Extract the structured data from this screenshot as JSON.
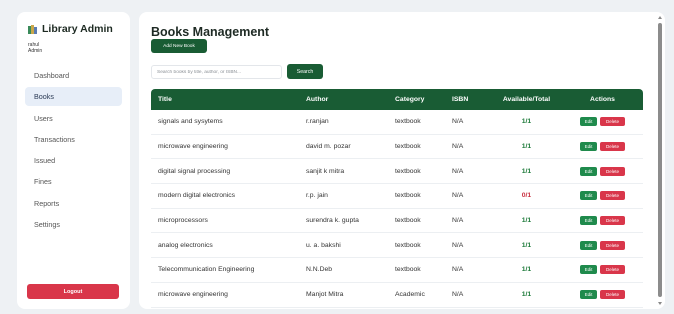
{
  "sidebar": {
    "brand": "Library Admin",
    "user_name": "rahul",
    "user_role": "Admin",
    "items": [
      {
        "label": "Dashboard"
      },
      {
        "label": "Books"
      },
      {
        "label": "Users"
      },
      {
        "label": "Transactions"
      },
      {
        "label": "Issued"
      },
      {
        "label": "Fines"
      },
      {
        "label": "Reports"
      },
      {
        "label": "Settings"
      }
    ],
    "active": "Books",
    "logout_label": "Logout"
  },
  "main": {
    "title": "Books Management",
    "add_label": "Add New Book",
    "search_placeholder": "Search books by title, author, or ISBN...",
    "search_label": "Search",
    "columns": {
      "title": "Title",
      "author": "Author",
      "category": "Category",
      "isbn": "ISBN",
      "available": "Available/Total",
      "actions": "Actions"
    },
    "edit_label": "Edit",
    "delete_label": "Delete",
    "rows": [
      {
        "title": "signals and sysytems",
        "author": "r.ranjan",
        "category": "textbook",
        "isbn": "N/A",
        "available": "1/1"
      },
      {
        "title": "microwave engineering",
        "author": "david m. pozar",
        "category": "textbook",
        "isbn": "N/A",
        "available": "1/1"
      },
      {
        "title": "digital signal processing",
        "author": "sanjit k mitra",
        "category": "textbook",
        "isbn": "N/A",
        "available": "1/1"
      },
      {
        "title": "modern digital electronics",
        "author": "r.p. jain",
        "category": "textbook",
        "isbn": "N/A",
        "available": "0/1"
      },
      {
        "title": "microprocessors",
        "author": "surendra k. gupta",
        "category": "textbook",
        "isbn": "N/A",
        "available": "1/1"
      },
      {
        "title": "analog electronics",
        "author": "u. a. bakshi",
        "category": "textbook",
        "isbn": "N/A",
        "available": "1/1"
      },
      {
        "title": "Telecommunication Engineering",
        "author": "N.N.Deb",
        "category": "textbook",
        "isbn": "N/A",
        "available": "1/1"
      },
      {
        "title": "microwave engineering",
        "author": "Manjot Mitra",
        "category": "Academic",
        "isbn": "N/A",
        "available": "1/1"
      }
    ]
  },
  "colors": {
    "primary": "#195c34",
    "danger": "#d9364a",
    "available": "#1d7a3a",
    "unavailable": "#c93040"
  }
}
